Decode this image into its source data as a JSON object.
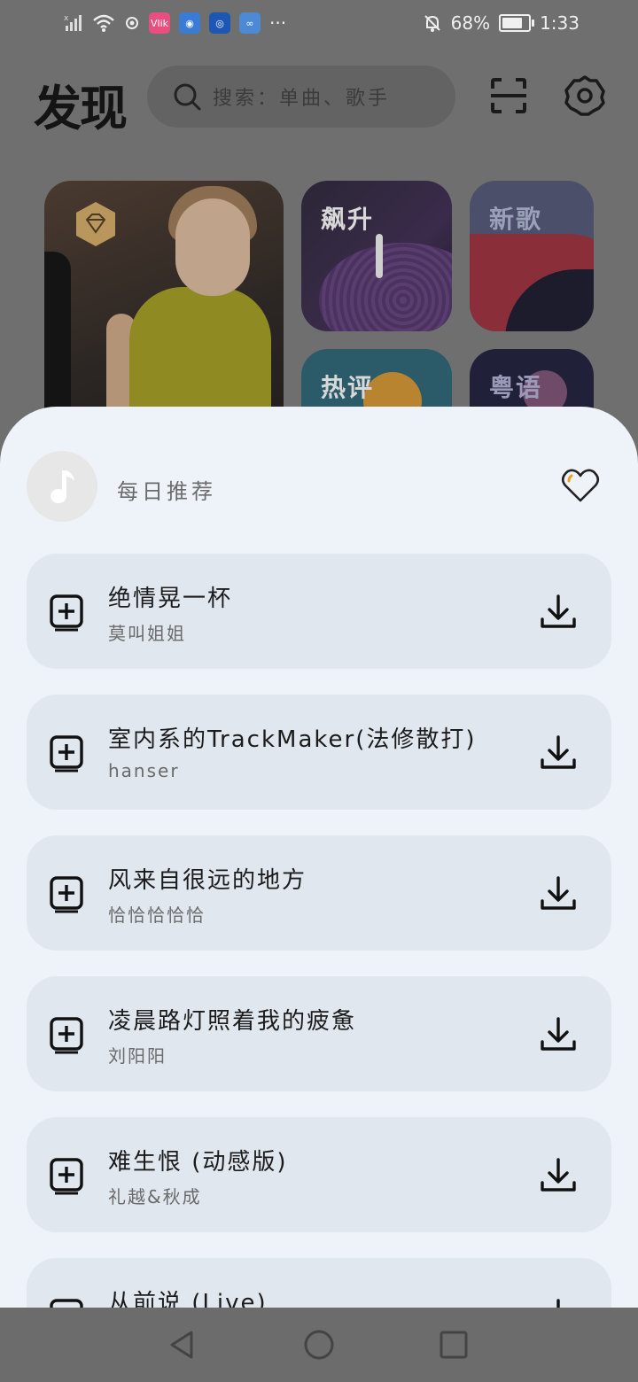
{
  "status_bar": {
    "battery": "68%",
    "time": "1:33",
    "more": "···",
    "apps": [
      {
        "name": "weibo-app-icon",
        "color": "#e84f7f",
        "glyph": "Vlik"
      },
      {
        "name": "app-icon-2",
        "color": "#3a7bd5",
        "glyph": "◉"
      },
      {
        "name": "app-icon-3",
        "color": "#1e56b3",
        "glyph": "◎"
      },
      {
        "name": "app-icon-4",
        "color": "#4c8ad6",
        "glyph": "∞"
      }
    ]
  },
  "header": {
    "title": "发现",
    "search_placeholder": "搜索：单曲、歌手"
  },
  "cards": {
    "trending": "飙升",
    "new": "新歌",
    "hot": "热评",
    "cantonese": "粤语"
  },
  "sheet": {
    "title": "每日推荐",
    "songs": [
      {
        "title": "绝情晃一杯",
        "artist": "莫叫姐姐"
      },
      {
        "title": "室内系的TrackMaker(法修散打)",
        "artist": "hanser"
      },
      {
        "title": "风来自很远的地方",
        "artist": "恰恰恰恰恰"
      },
      {
        "title": "凌晨路灯照着我的疲惫",
        "artist": "刘阳阳"
      },
      {
        "title": "难生恨 (动感版)",
        "artist": "礼越&秋成"
      },
      {
        "title": "从前说 (Live)",
        "artist": ""
      }
    ]
  },
  "colors": {
    "sheet_bg": "#eef3fa",
    "row_bg": "#e1e7ef",
    "heart_accent": "#f0a020"
  }
}
